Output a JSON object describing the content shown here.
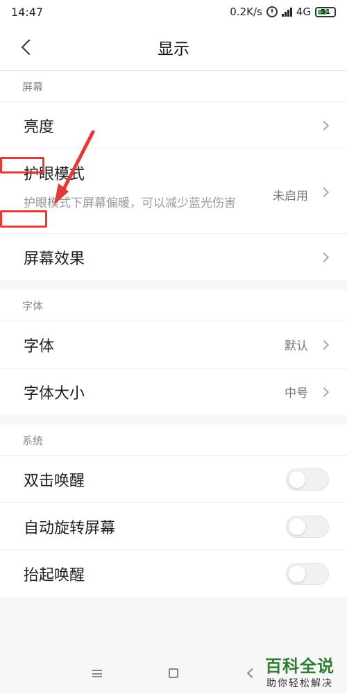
{
  "status_bar": {
    "time": "14:47",
    "network_speed": "0.2K/s",
    "network_type": "4G",
    "battery": "51"
  },
  "header": {
    "title": "显示"
  },
  "sections": {
    "screen": {
      "label": "屏幕",
      "items": [
        {
          "label": "亮度"
        },
        {
          "label": "护眼模式",
          "description": "护眼模式下屏幕偏暖，可以减少蓝光伤害",
          "value": "未启用"
        },
        {
          "label": "屏幕效果"
        }
      ]
    },
    "font": {
      "label": "字体",
      "items": [
        {
          "label": "字体",
          "value": "默认"
        },
        {
          "label": "字体大小",
          "value": "中号"
        }
      ]
    },
    "system": {
      "label": "系统",
      "items": [
        {
          "label": "双击唤醒",
          "toggle": false
        },
        {
          "label": "自动旋转屏幕",
          "toggle": false
        },
        {
          "label": "抬起唤醒",
          "toggle": false
        }
      ]
    }
  },
  "watermark": {
    "title": "百科全说",
    "subtitle": "助你轻松解决"
  },
  "colors": {
    "accent": "#e53935",
    "watermark": "#2e7d32"
  }
}
